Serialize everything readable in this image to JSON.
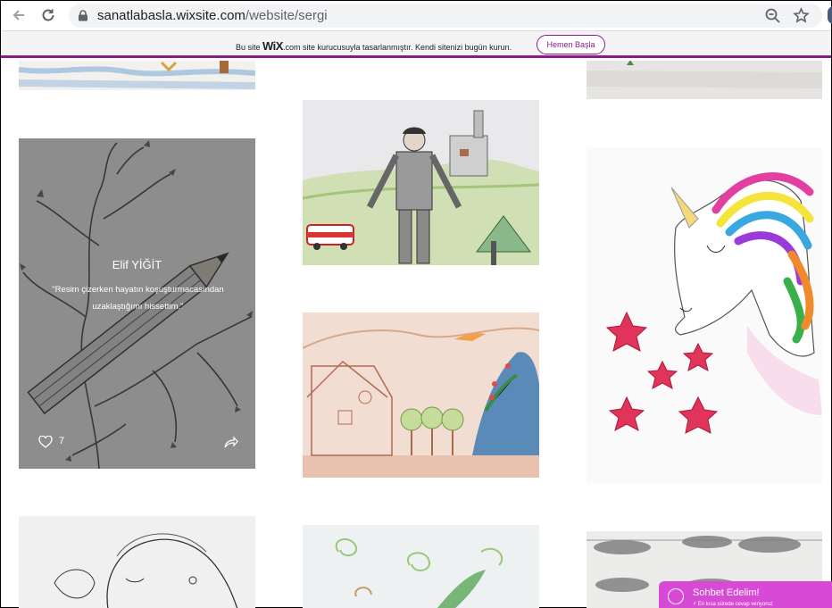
{
  "browser": {
    "url_host": "sanatlabasla.wixsite.com",
    "url_path": "/website/sergi"
  },
  "wix_banner": {
    "prefix": "Bu site",
    "logo": "WiX",
    "suffix": ".com site kurucusuyla tasarlanmıştır. Kendi sitenizi bugün kurun.",
    "cta": "Hemen Başla",
    "accent_color": "#8a1a8a"
  },
  "gallery": {
    "hovered_item": {
      "title": "Elif YİĞİT",
      "quote": "\"Resim çizerken hayatın koşuşturmacasından uzaklaştığımı hissettim.\"",
      "likes": "7"
    }
  },
  "chat_widget": {
    "title": "Sohbet Edelim!",
    "subtitle": "⚡ En kısa sürede cevap veriyoruz",
    "color": "#d64ad6"
  }
}
